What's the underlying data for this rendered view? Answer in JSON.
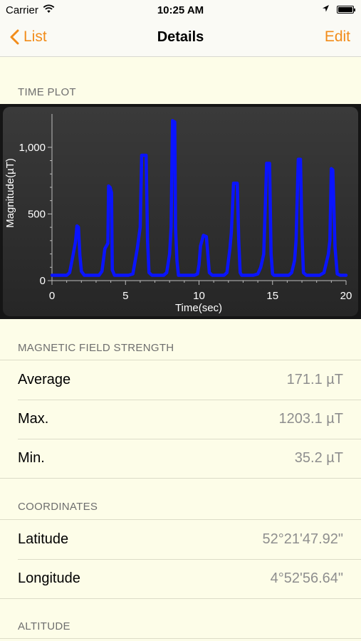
{
  "status": {
    "carrier": "Carrier",
    "time": "10:25 AM"
  },
  "nav": {
    "back_label": "List",
    "title": "Details",
    "edit_label": "Edit"
  },
  "sections": {
    "time_plot": "TIME PLOT",
    "magnetic": "MAGNETIC FIELD STRENGTH",
    "coordinates": "COORDINATES",
    "altitude": "ALTITUDE"
  },
  "magnetic": {
    "rows": [
      {
        "label": "Average",
        "value": "171.1 µT"
      },
      {
        "label": "Max.",
        "value": "1203.1 µT"
      },
      {
        "label": "Min.",
        "value": "35.2 µT"
      }
    ]
  },
  "coordinates": {
    "rows": [
      {
        "label": "Latitude",
        "value": "52°21'47.92\""
      },
      {
        "label": "Longitude",
        "value": "4°52'56.64\""
      }
    ]
  },
  "colors": {
    "accent": "#f28c1a",
    "series": "#0a14ff"
  },
  "chart_data": {
    "type": "line",
    "xlabel": "Time(sec)",
    "ylabel": "Magnitude(µT)",
    "xlim": [
      0,
      20
    ],
    "ylim": [
      0,
      1250
    ],
    "xticks": [
      "0",
      "5",
      "10",
      "15",
      "20"
    ],
    "yticks": [
      "0",
      "500",
      "1,000"
    ],
    "series": [
      {
        "values": [
          [
            0,
            40
          ],
          [
            1.0,
            40
          ],
          [
            1.2,
            60
          ],
          [
            1.45,
            200
          ],
          [
            1.6,
            290
          ],
          [
            1.7,
            410
          ],
          [
            1.8,
            400
          ],
          [
            1.9,
            190
          ],
          [
            2.0,
            70
          ],
          [
            2.2,
            40
          ],
          [
            3.2,
            40
          ],
          [
            3.4,
            70
          ],
          [
            3.6,
            240
          ],
          [
            3.8,
            280
          ],
          [
            3.85,
            710
          ],
          [
            3.95,
            700
          ],
          [
            4.05,
            660
          ],
          [
            4.1,
            80
          ],
          [
            4.25,
            40
          ],
          [
            5.2,
            40
          ],
          [
            5.5,
            50
          ],
          [
            5.8,
            240
          ],
          [
            6.0,
            400
          ],
          [
            6.1,
            940
          ],
          [
            6.4,
            940
          ],
          [
            6.5,
            300
          ],
          [
            6.6,
            60
          ],
          [
            6.8,
            40
          ],
          [
            7.6,
            40
          ],
          [
            7.8,
            60
          ],
          [
            8.0,
            200
          ],
          [
            8.1,
            400
          ],
          [
            8.2,
            1200
          ],
          [
            8.35,
            1190
          ],
          [
            8.4,
            400
          ],
          [
            8.5,
            150
          ],
          [
            8.6,
            40
          ],
          [
            9.7,
            40
          ],
          [
            9.9,
            50
          ],
          [
            10.0,
            120
          ],
          [
            10.1,
            260
          ],
          [
            10.3,
            340
          ],
          [
            10.5,
            330
          ],
          [
            10.6,
            200
          ],
          [
            10.7,
            60
          ],
          [
            10.9,
            40
          ],
          [
            11.7,
            40
          ],
          [
            11.9,
            60
          ],
          [
            12.1,
            240
          ],
          [
            12.2,
            360
          ],
          [
            12.35,
            730
          ],
          [
            12.6,
            730
          ],
          [
            12.7,
            300
          ],
          [
            12.8,
            60
          ],
          [
            12.9,
            40
          ],
          [
            13.7,
            40
          ],
          [
            14.0,
            50
          ],
          [
            14.2,
            100
          ],
          [
            14.4,
            200
          ],
          [
            14.6,
            880
          ],
          [
            14.8,
            880
          ],
          [
            14.9,
            200
          ],
          [
            15.0,
            50
          ],
          [
            15.1,
            40
          ],
          [
            16.1,
            40
          ],
          [
            16.3,
            60
          ],
          [
            16.5,
            150
          ],
          [
            16.6,
            300
          ],
          [
            16.75,
            910
          ],
          [
            16.9,
            910
          ],
          [
            17.0,
            350
          ],
          [
            17.1,
            60
          ],
          [
            17.3,
            40
          ],
          [
            18.2,
            40
          ],
          [
            18.5,
            60
          ],
          [
            18.8,
            200
          ],
          [
            18.9,
            300
          ],
          [
            19.0,
            840
          ],
          [
            19.1,
            830
          ],
          [
            19.25,
            250
          ],
          [
            19.4,
            50
          ],
          [
            19.6,
            40
          ],
          [
            20,
            40
          ]
        ]
      }
    ]
  }
}
